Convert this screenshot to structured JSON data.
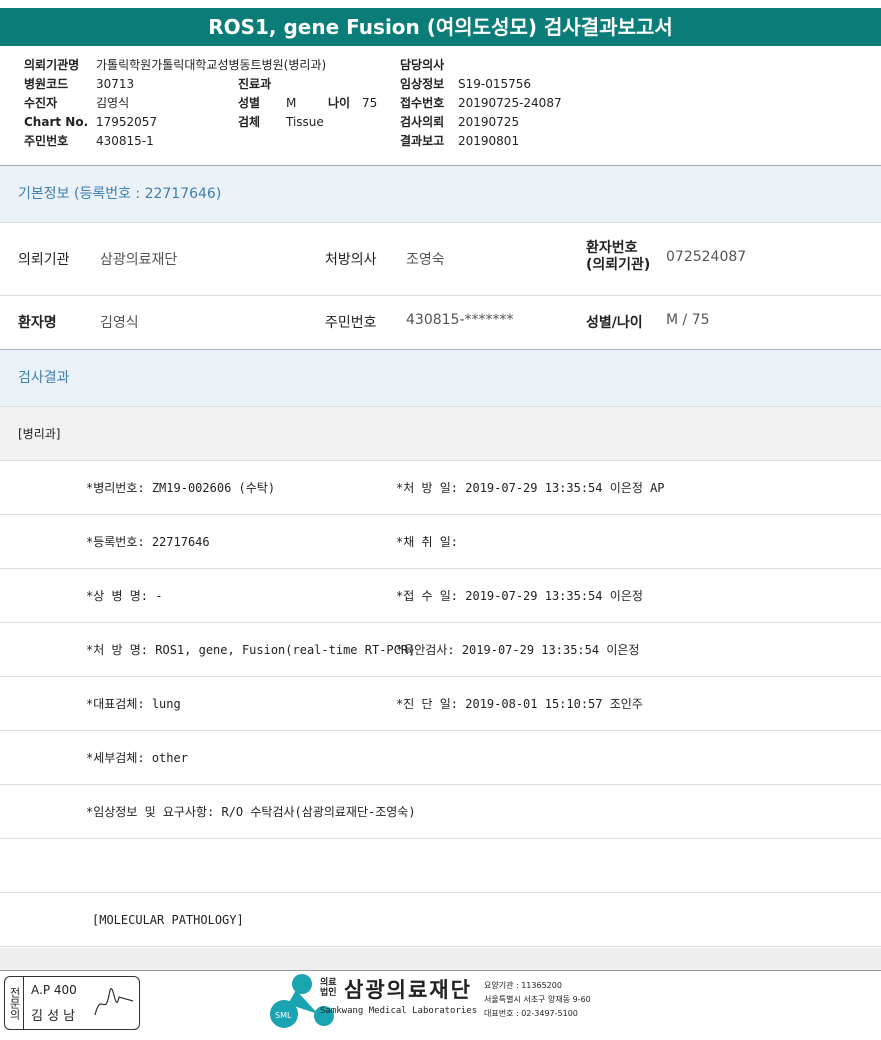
{
  "title": "ROS1, gene Fusion (여의도성모) 검사결과보고서",
  "header": {
    "institution_label": "의뢰기관명",
    "institution": "가톨릭학원가톨릭대학교성병동트병원(병리과)",
    "hospital_code_label": "병원코드",
    "hospital_code": "30713",
    "recipient_label": "수진자",
    "recipient": "김영식",
    "chart_label": "Chart No.",
    "chart": "17952057",
    "rrn_label": "주민번호",
    "rrn": "430815-1",
    "dept_label": "진료과",
    "dept": "",
    "sex_label": "성별",
    "sex": "M",
    "age_label": "나이",
    "age": "75",
    "specimen_label": "검체",
    "specimen": "Tissue",
    "doctor_label": "담당의사",
    "doctor": "",
    "clinical_label": "임상정보",
    "clinical": "S19-015756",
    "receipt_label": "접수번호",
    "receipt": "20190725-24087",
    "request_label": "검사의뢰",
    "request": "20190725",
    "report_label": "결과보고",
    "report": "20190801"
  },
  "basic": {
    "heading": "기본정보",
    "reg": "(등록번호 : 22717646)",
    "inst_label": "의뢰기관",
    "inst": "삼광의료재단",
    "presc_label": "처방의사",
    "presc": "조영숙",
    "pid_label": "환자번호\n(의뢰기관)",
    "pid": "072524087",
    "name_label": "환자명",
    "name": "김영식",
    "rrn_label": "주민번호",
    "rrn": "430815-*******",
    "sexage_label": "성별/나이",
    "sexage": "M / 75"
  },
  "results": {
    "heading": "검사결과",
    "dept": "[병리과]",
    "rows": [
      {
        "l": "*병리번호: ZM19-002606 (수탁)",
        "r": "*처 방 일: 2019-07-29 13:35:54  이은정 AP"
      },
      {
        "l": "*등록번호: 22717646",
        "r": "*채 취 일:"
      },
      {
        "l": "*상 병 명: -",
        "r": "*접 수 일: 2019-07-29 13:35:54  이은정"
      },
      {
        "l": "*처 방 명: ROS1, gene, Fusion(real-time RT-PCR)",
        "r": "*육안검사: 2019-07-29 13:35:54  이은정"
      },
      {
        "l": "*대표검체: lung",
        "r": "*진 단 일: 2019-08-01 15:10:57  조인주"
      },
      {
        "l": "*세부검체: other",
        "r": ""
      },
      {
        "l": "*임상정보 및 요구사항: R/O 수탁검사(삼광의료재단-조영숙)",
        "r": ""
      },
      {
        "l": "",
        "r": ""
      },
      {
        "l": " [MOLECULAR PATHOLOGY]",
        "r": ""
      }
    ]
  },
  "footer": {
    "stamp_label": "전문의",
    "ap": "A.P 400",
    "pathologist": "김 성 남",
    "logo_prefix": "의료\n법인",
    "logo_name": "삼광의료재단",
    "logo_en": "Samkwang Medical Laboratories",
    "logo_badge": "SML",
    "code": "요양기관 : 11365200",
    "address": "서울특별시 서초구 양재동 9-60",
    "phone": "대표번호 : 02-3497-5100"
  }
}
